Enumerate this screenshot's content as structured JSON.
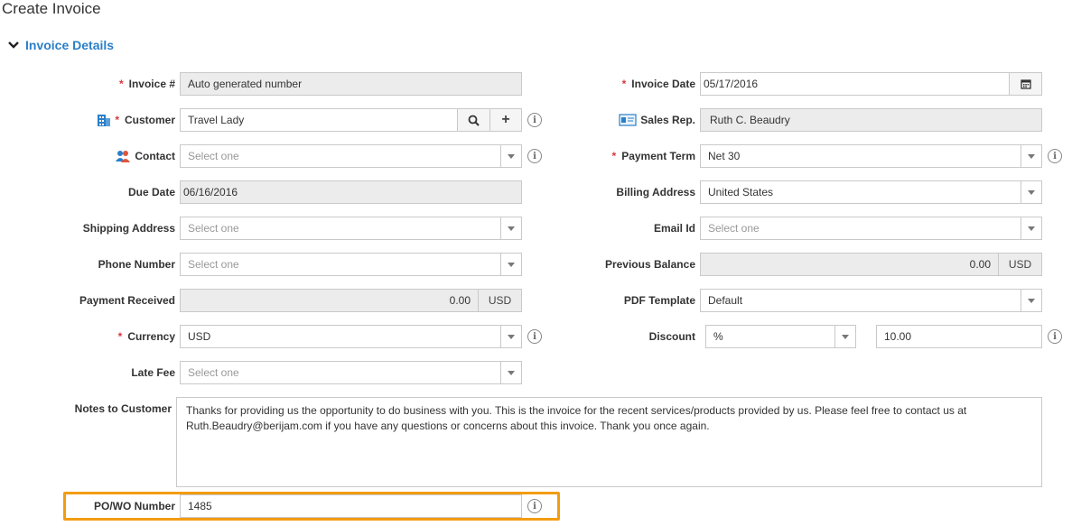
{
  "page": {
    "title": "Create Invoice"
  },
  "section": {
    "title": "Invoice Details"
  },
  "fields": {
    "invoice_no": {
      "label": "Invoice #",
      "value": "Auto generated number"
    },
    "customer": {
      "label": "Customer",
      "value": "Travel Lady"
    },
    "contact": {
      "label": "Contact",
      "placeholder": "Select one"
    },
    "due_date": {
      "label": "Due Date",
      "value": "06/16/2016"
    },
    "shipping_address": {
      "label": "Shipping Address",
      "placeholder": "Select one"
    },
    "phone_number": {
      "label": "Phone Number",
      "placeholder": "Select one"
    },
    "payment_received": {
      "label": "Payment Received",
      "value": "0.00",
      "unit": "USD"
    },
    "currency": {
      "label": "Currency",
      "value": "USD"
    },
    "late_fee": {
      "label": "Late Fee",
      "placeholder": "Select one"
    },
    "notes": {
      "label": "Notes to Customer",
      "value": "Thanks for providing us the opportunity to do business with you. This is the invoice for the recent services/products provided by us. Please feel free to contact us at Ruth.Beaudry@berijam.com if you have any questions or concerns about this invoice. Thank you once again."
    },
    "po_number": {
      "label": "PO/WO Number",
      "value": "1485"
    },
    "invoice_date": {
      "label": "Invoice Date",
      "value": "05/17/2016"
    },
    "sales_rep": {
      "label": "Sales Rep.",
      "value": "Ruth C. Beaudry"
    },
    "payment_term": {
      "label": "Payment Term",
      "value": "Net 30"
    },
    "billing_address": {
      "label": "Billing Address",
      "value": "United States"
    },
    "email_id": {
      "label": "Email Id",
      "placeholder": "Select one"
    },
    "previous_balance": {
      "label": "Previous Balance",
      "value": "0.00",
      "unit": "USD"
    },
    "pdf_template": {
      "label": "PDF Template",
      "value": "Default"
    },
    "discount": {
      "label": "Discount",
      "type": "%",
      "value": "10.00"
    }
  },
  "colors": {
    "accent": "#2a7fc8",
    "required": "#d9363e",
    "highlight": "#f39c12"
  },
  "icons": {
    "required_mark": "*",
    "info": "i",
    "customer": "building-icon",
    "contact": "contacts-icon",
    "sales_rep": "id-card-icon",
    "calendar": "calendar-icon",
    "search": "search-icon",
    "add": "+"
  }
}
